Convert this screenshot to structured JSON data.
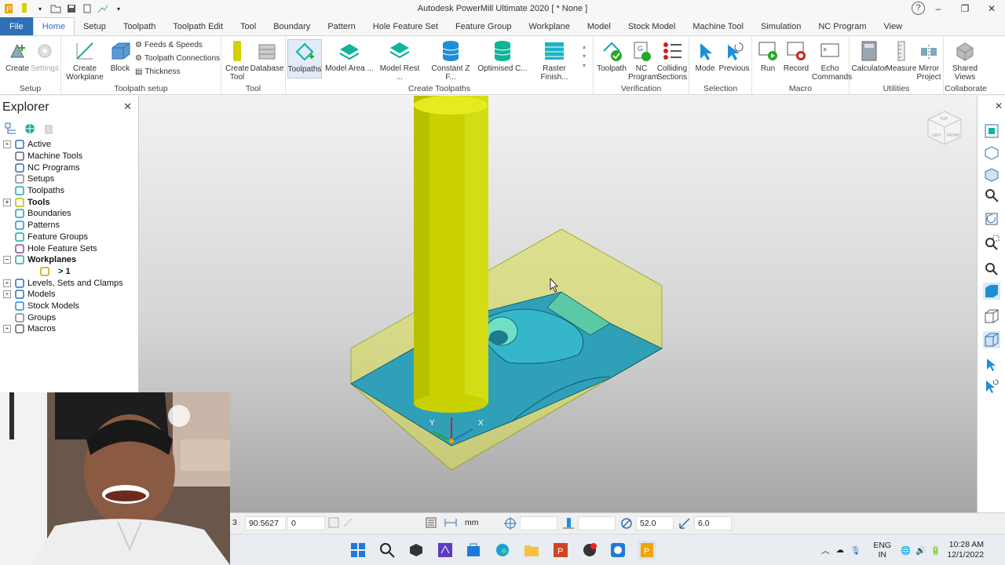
{
  "window": {
    "title": "Autodesk PowerMill Ultimate 2020    [ * None ]"
  },
  "tabs": [
    {
      "label": "File"
    },
    {
      "label": "Home"
    },
    {
      "label": "Setup"
    },
    {
      "label": "Toolpath"
    },
    {
      "label": "Toolpath Edit"
    },
    {
      "label": "Tool"
    },
    {
      "label": "Boundary"
    },
    {
      "label": "Pattern"
    },
    {
      "label": "Hole Feature Set"
    },
    {
      "label": "Feature Group"
    },
    {
      "label": "Workplane"
    },
    {
      "label": "Model"
    },
    {
      "label": "Stock Model"
    },
    {
      "label": "Machine Tool"
    },
    {
      "label": "Simulation"
    },
    {
      "label": "NC Program"
    },
    {
      "label": "View"
    }
  ],
  "ribbon": {
    "setup": {
      "label": "Setup",
      "create": "Create",
      "settings": "Settings"
    },
    "toolpath_setup": {
      "label": "Toolpath setup",
      "create_workplane": "Create Workplane",
      "block": "Block",
      "feeds_speeds": "Feeds & Speeds",
      "toolpath_connections": "Toolpath Connections",
      "thickness": "Thickness"
    },
    "tool": {
      "label": "Tool",
      "create_tool": "Create Tool",
      "database": "Database"
    },
    "create_toolpaths": {
      "label": "Create Toolpaths",
      "toolpaths": "Toolpaths",
      "model_area": "Model Area ...",
      "model_rest": "Model Rest ...",
      "constant_z": "Constant Z F...",
      "optimised": "Optimised C...",
      "raster": "Raster Finish..."
    },
    "verification": {
      "label": "Verification",
      "toolpath": "Toolpath",
      "nc_program": "NC Program",
      "colliding": "Colliding Sections"
    },
    "selection": {
      "label": "Selection",
      "mode": "Mode",
      "previous": "Previous"
    },
    "macro": {
      "label": "Macro",
      "run": "Run",
      "record": "Record",
      "echo": "Echo Commands"
    },
    "utilities": {
      "label": "Utilities",
      "calculator": "Calculator",
      "measure": "Measure",
      "mirror": "Mirror Project"
    },
    "collaborate": {
      "label": "Collaborate",
      "shared": "Shared Views"
    }
  },
  "explorer": {
    "title": "Explorer",
    "items": [
      {
        "label": "Active",
        "expandable": true,
        "bold": false,
        "icon": "active-icon"
      },
      {
        "label": "Machine Tools",
        "expandable": false,
        "bold": false,
        "icon": "machine-tools-icon"
      },
      {
        "label": "NC Programs",
        "expandable": false,
        "bold": false,
        "icon": "nc-programs-icon"
      },
      {
        "label": "Setups",
        "expandable": false,
        "bold": false,
        "icon": "setups-icon"
      },
      {
        "label": "Toolpaths",
        "expandable": false,
        "bold": false,
        "icon": "toolpaths-icon"
      },
      {
        "label": "Tools",
        "expandable": true,
        "bold": true,
        "icon": "tools-icon"
      },
      {
        "label": "Boundaries",
        "expandable": false,
        "bold": false,
        "icon": "boundaries-icon"
      },
      {
        "label": "Patterns",
        "expandable": false,
        "bold": false,
        "icon": "patterns-icon"
      },
      {
        "label": "Feature Groups",
        "expandable": false,
        "bold": false,
        "icon": "feature-groups-icon"
      },
      {
        "label": "Hole Feature Sets",
        "expandable": false,
        "bold": false,
        "icon": "hole-feature-sets-icon"
      },
      {
        "label": "Workplanes",
        "expandable": true,
        "bold": true,
        "icon": "workplanes-icon"
      },
      {
        "label": "> 1",
        "expandable": false,
        "bold": true,
        "icon": "workplane-icon",
        "child": true
      },
      {
        "label": "Levels, Sets and Clamps",
        "expandable": true,
        "bold": false,
        "icon": "levels-icon"
      },
      {
        "label": "Models",
        "expandable": true,
        "bold": false,
        "icon": "models-icon"
      },
      {
        "label": "Stock Models",
        "expandable": false,
        "bold": false,
        "icon": "stock-models-icon"
      },
      {
        "label": "Groups",
        "expandable": false,
        "bold": false,
        "icon": "groups-icon"
      },
      {
        "label": "Macros",
        "expandable": true,
        "bold": false,
        "icon": "macros-icon"
      }
    ]
  },
  "viewport": {
    "axis_x": "X",
    "axis_y": "Y",
    "viewcube_top": "TOP",
    "viewcube_front": "FRONT",
    "viewcube_left": "LEFT"
  },
  "statusbar": {
    "coord1": "3",
    "coord2": "90.5627",
    "coord3": "0",
    "units": "mm",
    "tolerance": "52.0",
    "thickness": "6.0"
  },
  "taskbar": {
    "lang1": "ENG",
    "lang2": "IN",
    "time": "10:28 AM",
    "date": "12/1/2022"
  },
  "colors": {
    "accent": "#2f6fb6",
    "tool": "#c9d200",
    "stock": "#d8e04a",
    "model": "#2fa0b8"
  }
}
